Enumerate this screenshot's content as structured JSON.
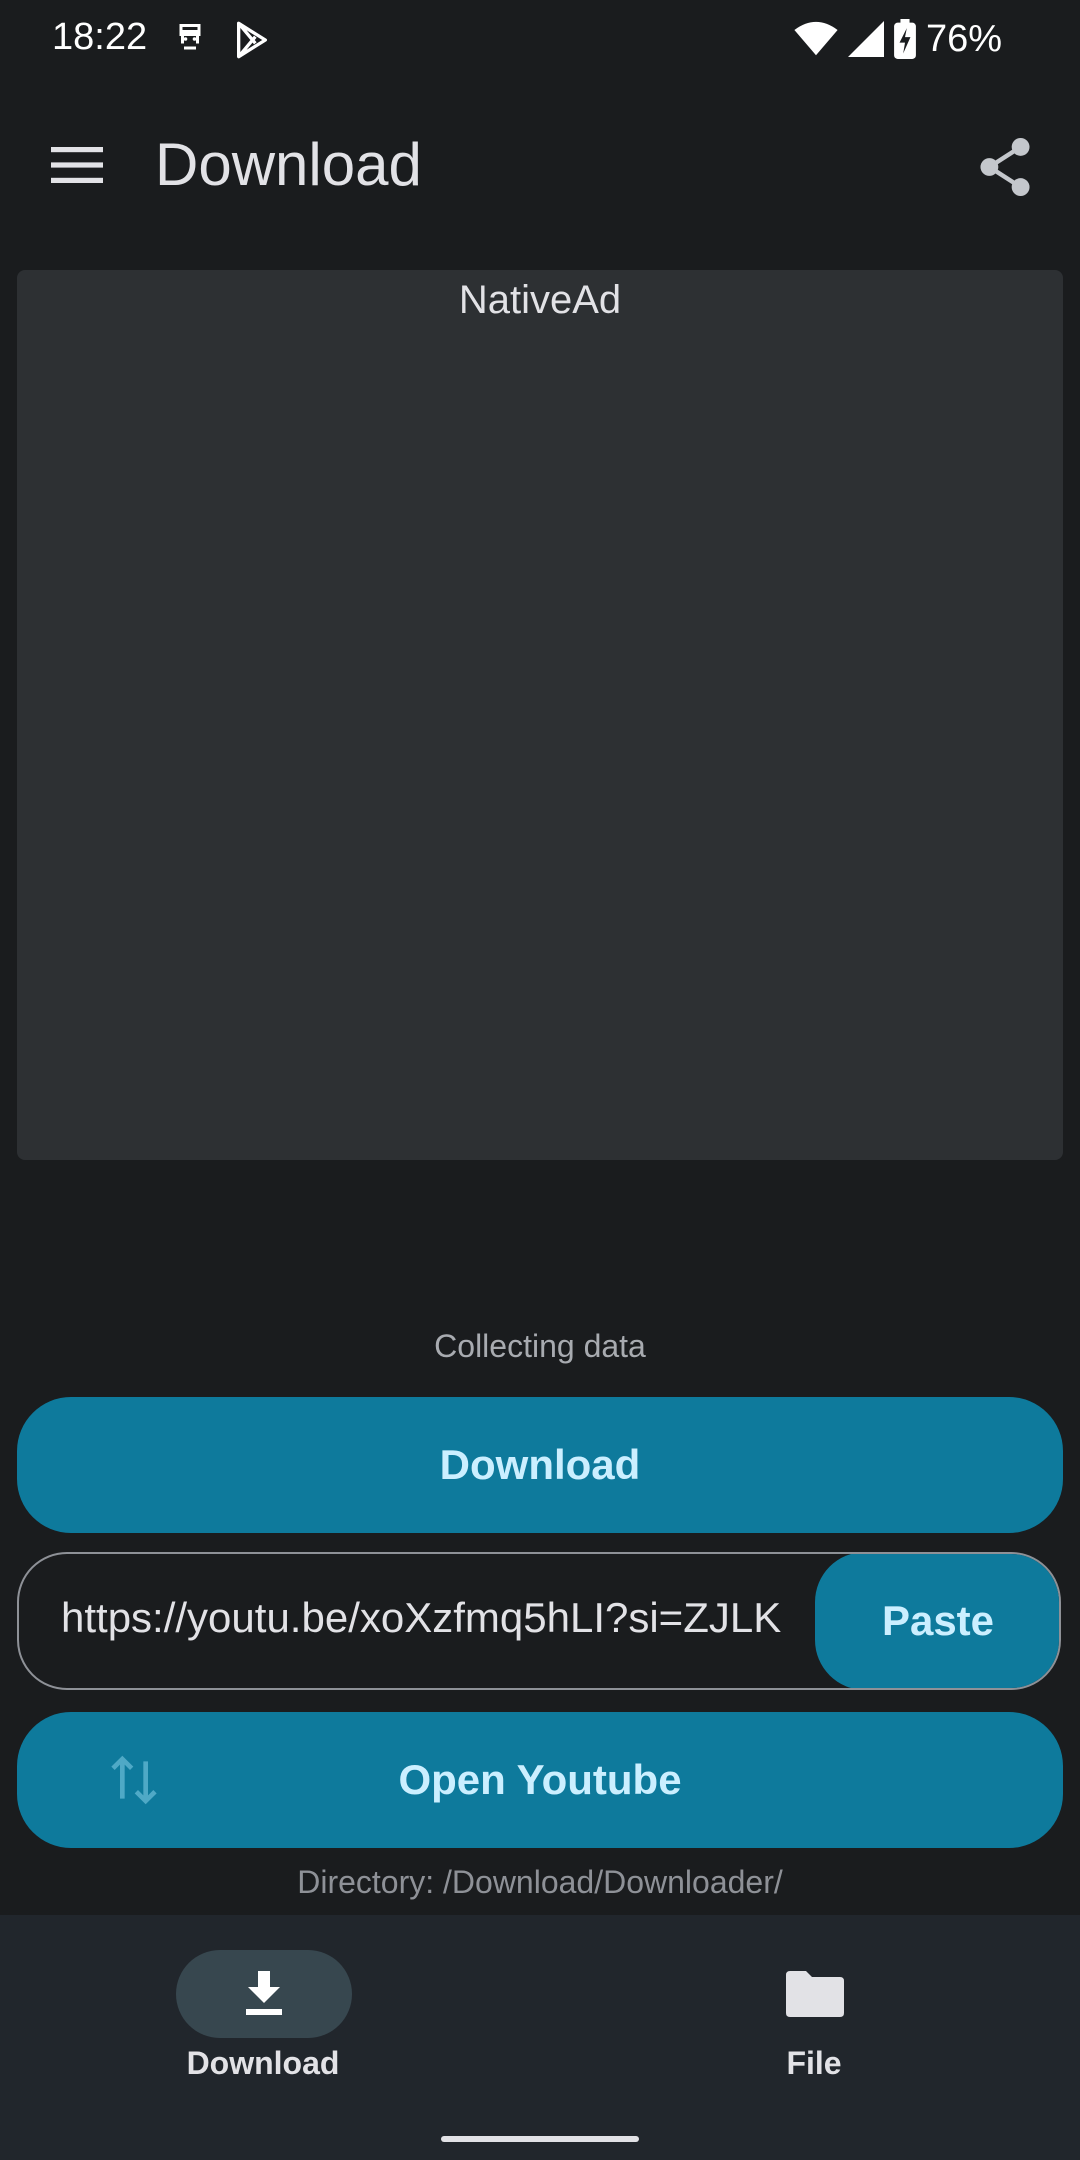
{
  "status_bar": {
    "time": "18:22",
    "battery": "76%",
    "icons": [
      "notification-face-icon",
      "play-store-icon",
      "wifi-icon",
      "signal-icon",
      "battery-charging-icon"
    ]
  },
  "app_bar": {
    "title": "Download",
    "menu_icon": "menu-icon",
    "share_icon": "share-icon"
  },
  "ad": {
    "label": "NativeAd"
  },
  "status_text": "Collecting data",
  "download_button": {
    "label": "Download"
  },
  "url_input": {
    "value": "https://youtu.be/xoXzfmq5hLI?si=ZJLK",
    "paste_label": "Paste"
  },
  "open_youtube_button": {
    "label": "Open Youtube",
    "icon": "swap-vertical-icon"
  },
  "directory_text": "Directory: /Download/Downloader/",
  "bottom_nav": {
    "items": [
      {
        "label": "Download",
        "icon": "download-icon",
        "selected": true
      },
      {
        "label": "File",
        "icon": "folder-icon",
        "selected": false
      }
    ]
  },
  "colors": {
    "background": "#1a1c1e",
    "accent": "#0e7a9c",
    "accent_text": "#cbefff",
    "ad_background": "#2d3033",
    "nav_background": "#21262c"
  }
}
